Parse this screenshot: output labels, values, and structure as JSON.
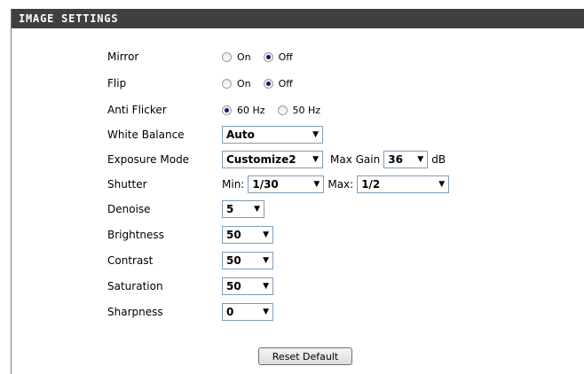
{
  "header": {
    "title": "IMAGE SETTINGS"
  },
  "mirror": {
    "label": "Mirror",
    "on": "On",
    "off": "Off"
  },
  "flip": {
    "label": "Flip",
    "on": "On",
    "off": "Off"
  },
  "anti_flicker": {
    "label": "Anti Flicker",
    "opt1": "60 Hz",
    "opt2": "50 Hz"
  },
  "white_balance": {
    "label": "White Balance",
    "value": "Auto"
  },
  "exposure": {
    "label": "Exposure Mode",
    "value": "Customize2",
    "max_gain_label": "Max Gain",
    "max_gain_value": "36",
    "unit": "dB"
  },
  "shutter": {
    "label": "Shutter",
    "min_label": "Min:",
    "min_value": "1/30",
    "max_label": "Max:",
    "max_value": "1/2"
  },
  "denoise": {
    "label": "Denoise",
    "value": "5"
  },
  "brightness": {
    "label": "Brightness",
    "value": "50"
  },
  "contrast": {
    "label": "Contrast",
    "value": "50"
  },
  "saturation": {
    "label": "Saturation",
    "value": "50"
  },
  "sharpness": {
    "label": "Sharpness",
    "value": "0"
  },
  "reset": {
    "label": "Reset Default"
  }
}
